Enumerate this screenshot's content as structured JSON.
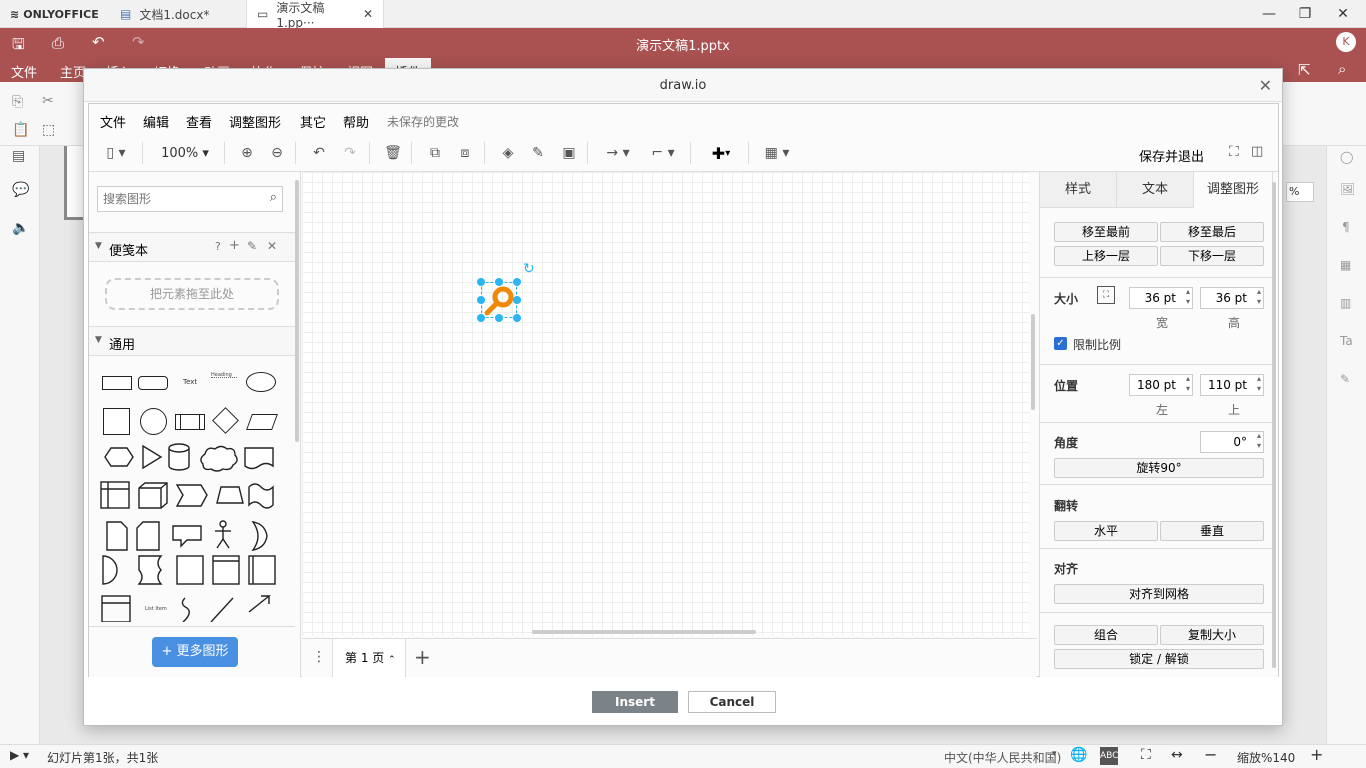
{
  "app": {
    "brand": "ONLYOFFICE",
    "tabs": [
      {
        "label": "文档1.docx*"
      },
      {
        "label": "演示文稿1.pp···"
      }
    ],
    "title": "演示文稿1.pptx",
    "user_initial": "K",
    "menu": [
      "文件",
      "主页",
      "插入",
      "切换",
      "动画",
      "协作",
      "保护",
      "视图",
      "插件"
    ]
  },
  "dialog": {
    "title": "draw.io",
    "insert_label": "Insert",
    "cancel_label": "Cancel"
  },
  "drawio": {
    "menu": [
      "文件",
      "编辑",
      "查看",
      "调整图形",
      "其它",
      "帮助"
    ],
    "unsaved": "未保存的更改",
    "zoom": "100%",
    "save_exit": "保存并退出",
    "search_placeholder": "搜索图形",
    "scratchpad": {
      "title": "便笺本",
      "help": "?",
      "drop_hint": "把元素拖至此处"
    },
    "general_title": "通用",
    "more_shapes": "更多图形",
    "page_tab": "第 1 页",
    "shape_text": {
      "text": "Text",
      "heading": "Heading",
      "list": "List Item"
    },
    "format": {
      "tabs": [
        "样式",
        "文本",
        "调整图形"
      ],
      "arrange": {
        "to_front": "移至最前",
        "to_back": "移至最后",
        "bring_forward": "上移一层",
        "send_backward": "下移一层"
      },
      "size": {
        "label": "大小",
        "width": "36 pt",
        "height": "36 pt",
        "width_label": "宽",
        "height_label": "高",
        "constrain": "限制比例"
      },
      "position": {
        "label": "位置",
        "left": "180 pt",
        "top": "110 pt",
        "left_label": "左",
        "top_label": "上"
      },
      "angle": {
        "label": "角度",
        "value": "0°",
        "rotate": "旋转90°"
      },
      "flip": {
        "label": "翻转",
        "horizontal": "水平",
        "vertical": "垂直"
      },
      "align": {
        "label": "对齐",
        "to_grid": "对齐到网格"
      },
      "group": "组合",
      "copy_size": "复制大小",
      "lock": "锁定 / 解锁"
    }
  },
  "ribbon": {
    "right_value": "%"
  },
  "statusbar": {
    "slide_info": "幻灯片第1张，共1张",
    "language": "中文(中华人民共和国)",
    "zoom": "缩放%140"
  },
  "colors": {
    "accent": "#aa5252",
    "selection": "#29b6f2",
    "magnifier": "#f08705",
    "button_blue": "#4a90e2"
  }
}
